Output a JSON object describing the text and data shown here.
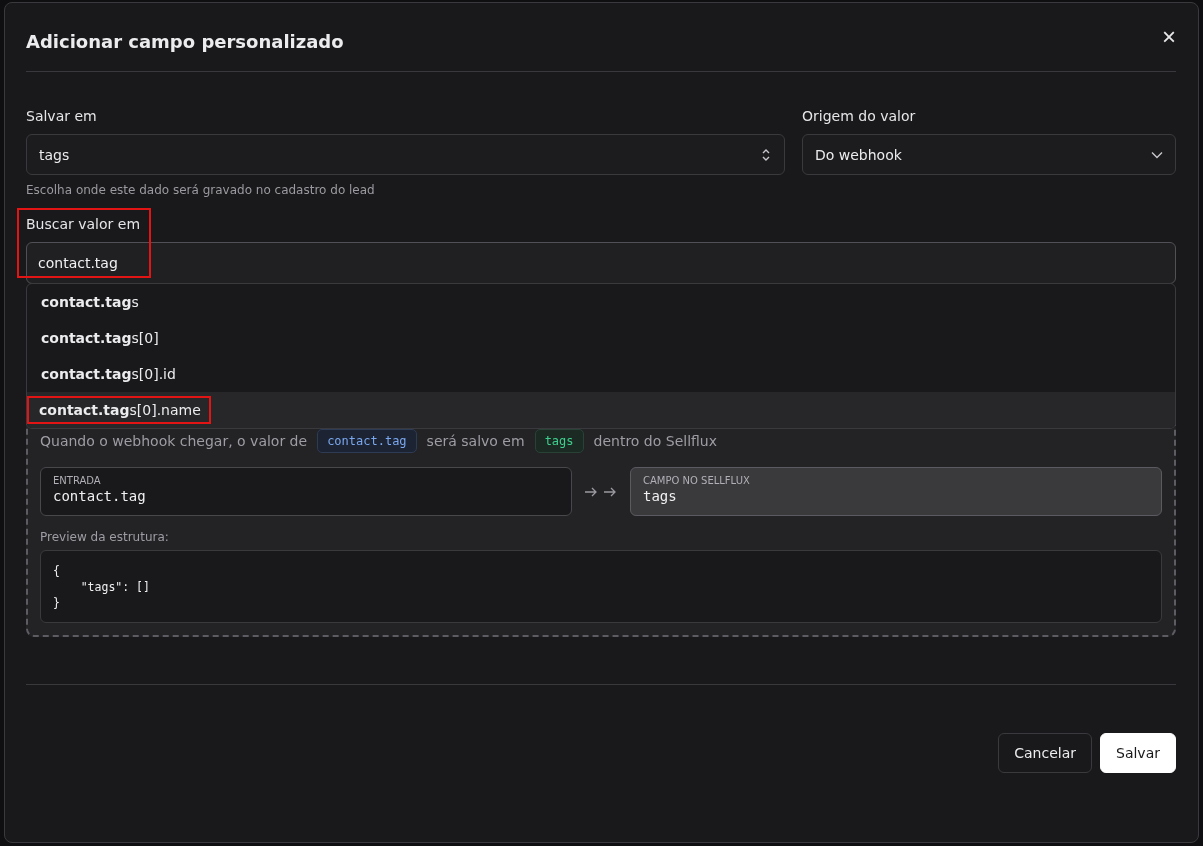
{
  "dialog": {
    "title": "Adicionar campo personalizado",
    "close_label": "×"
  },
  "save_to": {
    "label": "Salvar em",
    "value": "tags",
    "hint": "Escolha onde este dado será gravado no cadastro do lead"
  },
  "value_origin": {
    "label": "Origem do valor",
    "value": "Do webhook"
  },
  "search_field": {
    "label": "Buscar valor em",
    "value": "contact.tag",
    "highlighted": true
  },
  "suggestions": [
    {
      "text": "**contact.tag**s",
      "selected": false,
      "highlighted": false
    },
    {
      "text": "**contact.tag**s[0]",
      "selected": false,
      "highlighted": false
    },
    {
      "text": "**contact.tag**s[0].id",
      "selected": false,
      "highlighted": false
    },
    {
      "text": "**contact.tag**s[0].name",
      "selected": true,
      "highlighted": true
    }
  ],
  "how_it_works": {
    "sentence": [
      {
        "kind": "text",
        "text": "Quando o webhook chegar,  o valor de"
      },
      {
        "kind": "source",
        "text": "contact.tag"
      },
      {
        "kind": "text",
        "text": "será salvo em"
      },
      {
        "kind": "target",
        "text": "tags"
      },
      {
        "kind": "text",
        "text": "dentro do Sellflux"
      }
    ],
    "input": {
      "label": "ENTRADA",
      "value": "contact.tag"
    },
    "output": {
      "label": "CAMPO NO SELLFLUX",
      "value": "tags"
    },
    "preview_label": "Preview da estrutura:",
    "preview_lines": [
      "{",
      "    \"tags\": []",
      "}"
    ]
  },
  "buttons": [
    {
      "label": "Cancelar",
      "kind": "secondary"
    },
    {
      "label": "Salvar",
      "kind": "primary"
    }
  ]
}
